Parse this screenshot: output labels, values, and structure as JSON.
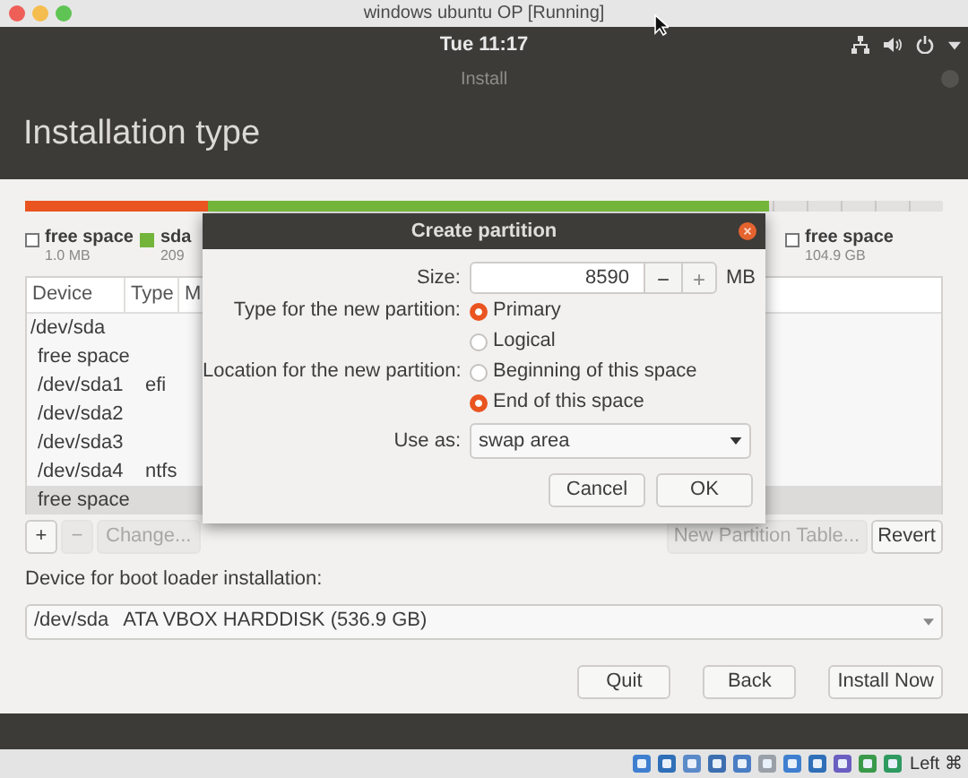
{
  "host_window": {
    "title": "windows ubuntu OP [Running]"
  },
  "top_bar": {
    "clock": "Tue 11:17"
  },
  "installer": {
    "title": "Install",
    "heading": "Installation type"
  },
  "partition_bar": [
    {
      "color": "#e95420",
      "level": 0.2
    },
    {
      "color": "#73b43a",
      "level": 0.81
    }
  ],
  "legend": [
    {
      "kind": "free",
      "label": "free space",
      "size": "1.0 MB"
    },
    {
      "kind": "used",
      "color": "#73b43a",
      "label": "sda",
      "size": "209"
    },
    {
      "kind": "free",
      "label": "free space",
      "size": "104.9 GB"
    }
  ],
  "table": {
    "columns": [
      "Device",
      "Type",
      "M"
    ],
    "rows": [
      {
        "device": "/dev/sda",
        "selected": false,
        "children": [
          {
            "device": "free space",
            "selected": false
          },
          {
            "device": "/dev/sda1",
            "type": "efi",
            "selected": false
          },
          {
            "device": "/dev/sda2",
            "selected": false
          },
          {
            "device": "/dev/sda3",
            "selected": false
          },
          {
            "device": "/dev/sda4",
            "type": "ntfs",
            "selected": false
          },
          {
            "device": "free space",
            "selected": true
          }
        ]
      }
    ]
  },
  "toolbar": {
    "left": [
      {
        "label": "+",
        "disabled": false
      },
      {
        "label": "−",
        "disabled": true
      },
      {
        "label": "Change...",
        "disabled": true
      }
    ],
    "right": [
      {
        "label": "New Partition Table...",
        "disabled": true
      },
      {
        "label": "Revert",
        "disabled": false
      }
    ]
  },
  "boot_loader": {
    "label": "Device for boot loader installation:",
    "device": "/dev/sda",
    "description": "ATA VBOX HARDDISK (536.9 GB)"
  },
  "actions": [
    "Quit",
    "Back",
    "Install Now"
  ],
  "dialog": {
    "title": "Create partition",
    "size": {
      "label": "Size:",
      "value": "8590",
      "decrease": "−",
      "increase": "+",
      "unit": "MB"
    },
    "groups": [
      {
        "label": "Type for the new partition:",
        "options": [
          {
            "label": "Primary",
            "selected": true
          },
          {
            "label": "Logical",
            "selected": false
          }
        ]
      },
      {
        "label": "Location for the new partition:",
        "options": [
          {
            "label": "Beginning of this space",
            "selected": false
          },
          {
            "label": "End of this space",
            "selected": true
          }
        ]
      }
    ],
    "use_as": {
      "label": "Use as:",
      "value": "swap area"
    },
    "buttons": [
      "Cancel",
      "OK"
    ]
  },
  "status_bar": {
    "host_key": "Left ⌘"
  }
}
